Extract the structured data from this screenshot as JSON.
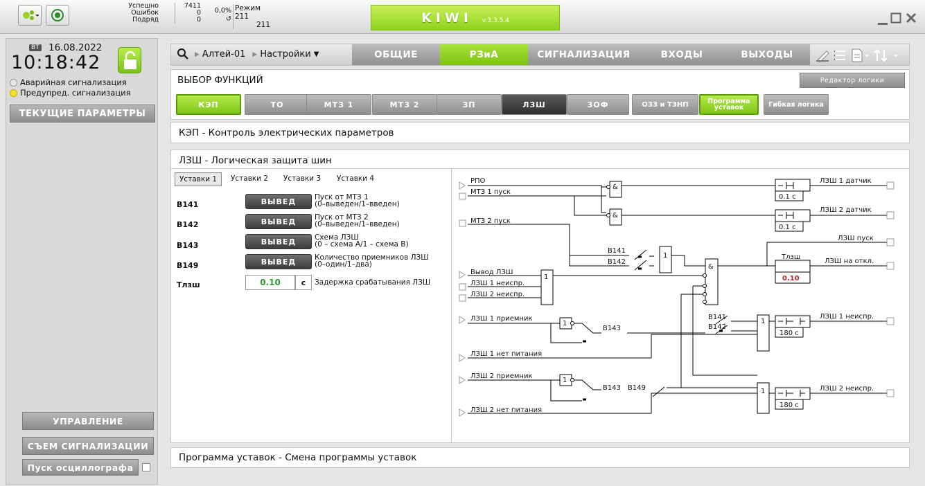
{
  "topbar": {
    "stats": {
      "success_label": "Успешно",
      "errors_label": "Ошибок",
      "row_label": "Подряд",
      "success_value": "7411",
      "errors_value": "0",
      "row_value": "0",
      "percent": "0,0%",
      "mode_label": "Режим",
      "mode_value_1": "211",
      "mode_value_2": "211"
    },
    "app_name": "KIWI",
    "version": "v.3.3.5.4"
  },
  "left": {
    "weekday": "ВТ",
    "date": "16.08.2022",
    "time": "10:18:42",
    "alarm_label": "Аварийная сигнализация",
    "warn_label": "Предупред. сигнализация",
    "current_params": "ТЕКУЩИЕ ПАРАМЕТРЫ",
    "control": "УПРАВЛЕНИЕ",
    "reset_alarm": "СЪЕМ СИГНАЛИЗАЦИИ",
    "osc_start": "Пуск осциллографа"
  },
  "nav": {
    "device": "Алтей-01",
    "settings": "Настройки",
    "tabs": [
      "ОБЩИЕ",
      "РЗиА",
      "СИГНАЛИЗАЦИЯ",
      "ВХОДЫ",
      "ВЫХОДЫ"
    ]
  },
  "functions": {
    "title": "ВЫБОР ФУНКЦИЙ",
    "logic_editor": "Редактор логики",
    "buttons": [
      "КЭП",
      "ТО",
      "МТЗ 1",
      "МТЗ 2",
      "ЗП",
      "ЛЗШ",
      "ЗОФ",
      "ОЗЗ и ТЗНП",
      "Программа уставок",
      "Гибкая логика"
    ]
  },
  "kep_panel": "КЭП - Контроль электрических параметров",
  "lzsh": {
    "title": "ЛЗШ - Логическая защита шин",
    "setting_tabs": [
      "Уставки 1",
      "Уставки 2",
      "Уставки 3",
      "Уставки 4"
    ],
    "rows": [
      {
        "code": "В141",
        "value": "ВЫВЕД",
        "desc1": "Пуск от МТЗ 1",
        "desc2": "(0–выведен/1–введен)"
      },
      {
        "code": "В142",
        "value": "ВЫВЕД",
        "desc1": "Пуск от МТЗ 2",
        "desc2": "(0–выведен/1–введен)"
      },
      {
        "code": "В143",
        "value": "ВЫВЕД",
        "desc1": "Схема ЛЗШ",
        "desc2": "(0 – схема А/1 – схема В)"
      },
      {
        "code": "В149",
        "value": "ВЫВЕД",
        "desc1": "Количество приемников ЛЗШ",
        "desc2": "(0–один/1–два)"
      }
    ],
    "delay": {
      "code": "Тлзш",
      "value": "0.10",
      "unit": "с",
      "desc": "Задержка срабатывания ЛЗШ"
    }
  },
  "diagram": {
    "rpo": "РПО",
    "mtz1": "МТЗ 1 пуск",
    "mtz2": "МТЗ 2 пуск",
    "out_lzsh": "Вывод ЛЗШ",
    "fault1": "ЛЗШ 1 неиспр.",
    "fault2": "ЛЗШ 2 неиспр.",
    "recv1": "ЛЗШ 1 приемник",
    "nopow1": "ЛЗШ 1 нет питания",
    "recv2": "ЛЗШ 2 приемник",
    "nopow2": "ЛЗШ 2 нет питания",
    "sensor1": "ЛЗШ 1 датчик",
    "sensor2": "ЛЗШ 2 датчик",
    "start": "ЛЗШ пуск",
    "trip": "ЛЗШ на откл.",
    "fault1_out": "ЛЗШ 1 неиспр.",
    "fault2_out": "ЛЗШ 2 неиспр.",
    "t01": "0.1 с",
    "t180": "180 с",
    "tlzsh": "Тлзш",
    "tlzsh_val": "0.10",
    "b141": "В141",
    "b142": "В142",
    "b143": "В143",
    "b149": "В149",
    "and": "&",
    "one": "1"
  },
  "prog_panel": "Программа уставок - Смена программы уставок"
}
